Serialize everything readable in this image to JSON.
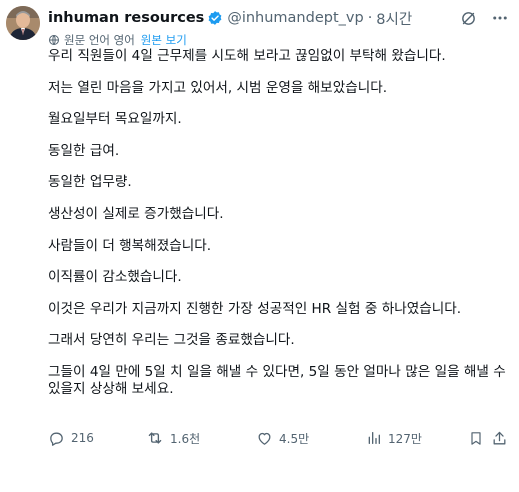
{
  "tweet": {
    "author_name": "inhuman resources",
    "handle": "@inhumandept_vp",
    "separator": "·",
    "time": "8시간",
    "translation_note": "원문 언어 영어",
    "show_original": "원본 보기",
    "paragraphs": [
      "우리 직원들이 4일 근무제를 시도해 보라고 끊임없이 부탁해 왔습니다.",
      "저는 열린 마음을 가지고 있어서, 시범 운영을 해보았습니다.",
      "월요일부터 목요일까지.",
      "동일한 급여.",
      "동일한 업무량.",
      "생산성이 실제로 증가했습니다.",
      "사람들이 더 행복해졌습니다.",
      "이직률이 감소했습니다.",
      "이것은 우리가 지금까지 진행한 가장 성공적인 HR 실험 중 하나였습니다.",
      "그래서 당연히 우리는 그것을 종료했습니다.",
      "그들이 4일 만에 5일 치 일을 해낼 수 있다면, 5일 동안 얼마나 많은 일을 해낼 수 있을지 상상해 보세요."
    ],
    "stats": {
      "replies": "216",
      "reposts": "1.6천",
      "likes": "4.5만",
      "views": "127만"
    }
  },
  "colors": {
    "verified": "#1d9bf0",
    "muted": "#536471",
    "link": "#1d9bf0",
    "text": "#0f1419"
  },
  "icons": [
    "verified-badge-icon",
    "grok-icon",
    "more-icon",
    "translate-icon",
    "reply-icon",
    "repost-icon",
    "like-icon",
    "views-icon",
    "bookmark-icon",
    "share-icon"
  ]
}
